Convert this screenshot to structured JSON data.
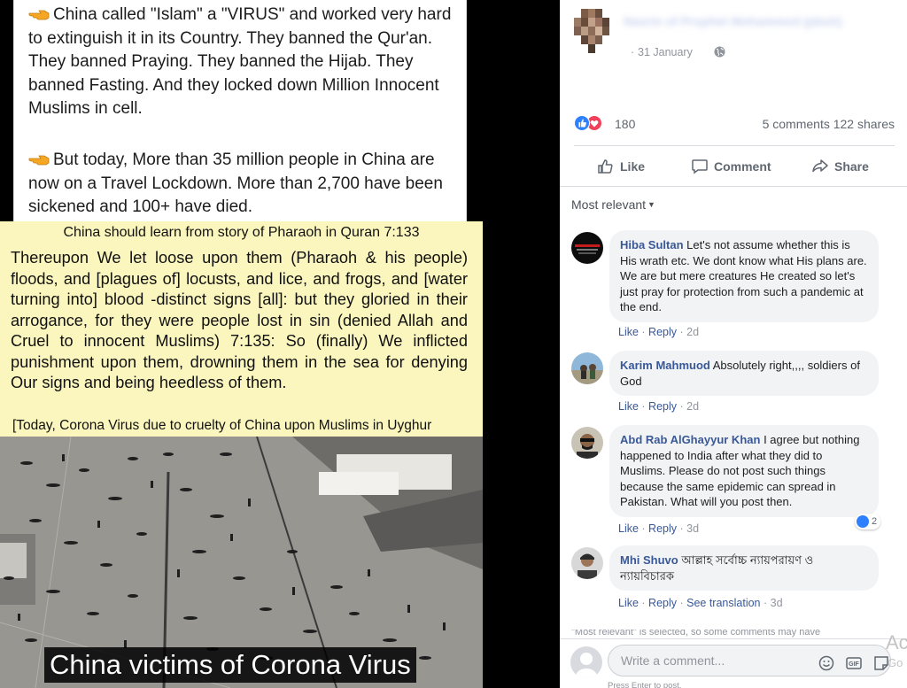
{
  "left_image": {
    "para_1": "China called \"Islam\" a \"VIRUS\" and worked very hard to extinguish it in its Country. They banned the Qur'an. They banned Praying. They banned the Hijab. They banned Fasting. And they locked down Million Innocent Muslims in cell.",
    "para_2": "But today, More than 35 million people in China are now on a Travel Lockdown. More than 2,700 have been sickened and 100+ have died.",
    "quran_heading": "China should learn from story of Pharaoh in Quran 7:133",
    "quran_body": "Thereupon We let loose upon them (Pharaoh & his people) floods, and [plagues of] locusts, and lice, and frogs, and [water turning into] blood -distinct signs [all]: but they gloried in their arrogance, for they were people lost in sin (denied Allah and Cruel to innocent Muslims) 7:135: So (finally) We inflicted punishment upon them, drowning them in the sea for denying Our signs and being heedless of them.",
    "quran_footer": "[Today, Corona Virus due to cruelty of China upon Muslims in Uyghur",
    "photo_caption": "China victims of Corona Virus",
    "hand_icon": "pointing-hand-icon"
  },
  "post": {
    "author": "Nasrin of Prophet Mohammed (pbuh)",
    "date": "31 January",
    "dot": "·",
    "reaction_count": "180",
    "comments_shares": "5 comments  122 shares",
    "actions": {
      "like": "Like",
      "comment": "Comment",
      "share": "Share"
    },
    "sort_label": "Most relevant",
    "colors": {
      "link": "#385898",
      "like_blue": "#2e80ff",
      "love_red": "#f0405a"
    }
  },
  "comments": [
    {
      "author": "Hiba Sultan",
      "text": "Let's not assume whether this is His wrath etc. We dont know what His plans are. We are but mere creatures He created so let's just pray for protection from such a pandemic at the end.",
      "like": "Like",
      "reply": "Reply",
      "time": "2d"
    },
    {
      "author": "Karim Mahmuod",
      "text": "Absolutely right,,,, soldiers of God",
      "like": "Like",
      "reply": "Reply",
      "time": "2d"
    },
    {
      "author": "Abd Rab AlGhayyur Khan",
      "text": "I agree but nothing happened to India after what they did to Muslims. Please do not post such things because the same epidemic can spread in Pakistan. What will you post then.",
      "like": "Like",
      "reply": "Reply",
      "time": "3d",
      "reactions": "2"
    },
    {
      "author": "Mhi Shuvo",
      "text": "আল্লাহ সর্বোচ্চ ন্যায়পরায়ণ ও ন্যায়বিচারক",
      "like": "Like",
      "reply": "Reply",
      "translate": "See translation",
      "time": "3d"
    }
  ],
  "notice": "\"Most relevant\" is selected, so some comments may have",
  "composer": {
    "placeholder": "Write a comment...",
    "hint": "Press Enter to post."
  },
  "watermark": {
    "line1": "Ac",
    "line2": "Go"
  }
}
